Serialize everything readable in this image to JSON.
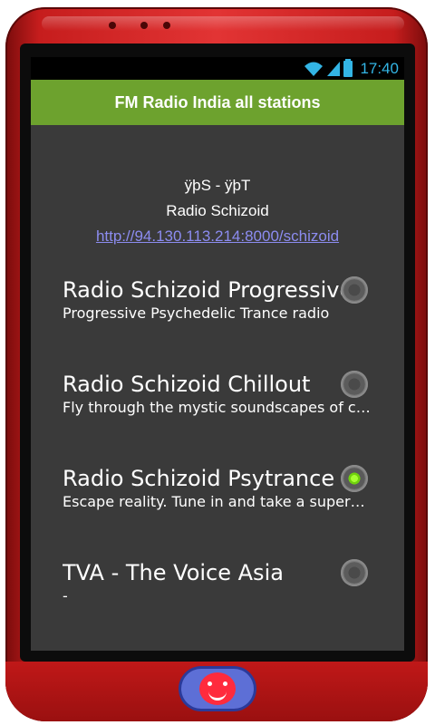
{
  "status_bar": {
    "time": "17:40"
  },
  "app_bar": {
    "title": "FM Radio India all stations"
  },
  "now_playing": {
    "title": "ÿþS - ÿþT",
    "station": "Radio Schizoid",
    "url": "http://94.130.113.214:8000/schizoid"
  },
  "stations": [
    {
      "name": "Radio Schizoid Progressive",
      "description": "Progressive Psychedelic Trance radio",
      "selected": false
    },
    {
      "name": "Radio Schizoid Chillout",
      "description": "Fly through the mystic soundscapes of chillout",
      "selected": false
    },
    {
      "name": "Radio Schizoid Psytrance",
      "description": "Escape reality. Tune in and take a superb ride",
      "selected": true
    },
    {
      "name": "TVA - The Voice Asia",
      "description": "-",
      "selected": false
    }
  ],
  "colors": {
    "appbar": "#6da22e",
    "background": "#3a3a3a",
    "status_accent": "#33b5e5",
    "link": "#8c8cf0",
    "radio_checked": "#6fd10d",
    "phone_frame": "#e23434"
  },
  "icons": [
    "wifi-icon",
    "signal-icon",
    "battery-icon",
    "radio-button-icon",
    "home-face-icon"
  ]
}
